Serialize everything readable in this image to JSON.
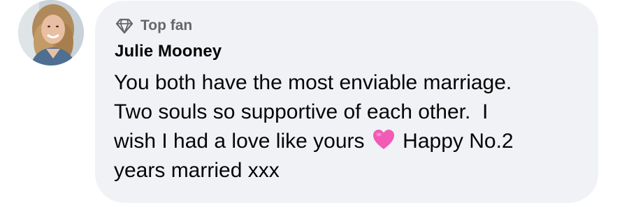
{
  "comment": {
    "badge_label": "Top fan",
    "author_name": "Julie Mooney",
    "text_line_1": "You both have the most enviable marriage.",
    "text_line_2": "Two souls so supportive of each other.  I",
    "text_line_3a": "wish I had a love like yours ",
    "text_line_3b": " Happy No.2",
    "text_line_4": "years married xxx",
    "emoji": "pink-heart",
    "colors": {
      "bubble": "#f0f2f5",
      "text": "#050505",
      "secondary_text": "#65676b",
      "heart": "#f15bb5"
    }
  }
}
